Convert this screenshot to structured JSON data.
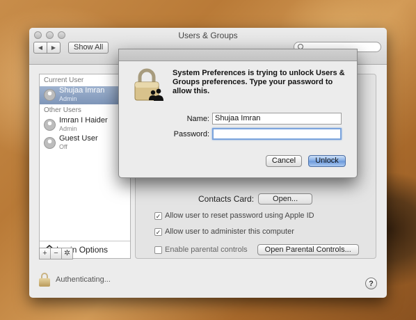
{
  "window": {
    "title": "Users & Groups",
    "nav_back": "◀",
    "nav_forward": "▶",
    "show_all": "Show All",
    "search_placeholder": ""
  },
  "sidebar": {
    "current_user_header": "Current User",
    "current_user": {
      "name": "Shujaa Imran",
      "role": "Admin"
    },
    "other_users_header": "Other Users",
    "other_users": [
      {
        "name": "Imran I Haider",
        "role": "Admin"
      },
      {
        "name": "Guest User",
        "role": "Off"
      }
    ],
    "login_options": "Login Options",
    "add_label": "+",
    "remove_label": "−",
    "action_label": "✲"
  },
  "panel": {
    "contacts_card_label": "Contacts Card:",
    "open_button": "Open...",
    "checks": [
      {
        "label": "Allow user to reset password using Apple ID",
        "checked": true
      },
      {
        "label": "Allow user to administer this computer",
        "checked": true
      },
      {
        "label": "Enable parental controls",
        "checked": false
      }
    ],
    "parental_button": "Open Parental Controls..."
  },
  "footer": {
    "status": "Authenticating...",
    "help": "?"
  },
  "dialog": {
    "message": "System Preferences is trying to unlock Users & Groups preferences. Type your password to allow this.",
    "name_label": "Name:",
    "name_value": "Shujaa Imran",
    "password_label": "Password:",
    "password_value": "",
    "cancel": "Cancel",
    "unlock": "Unlock"
  },
  "colors": {
    "accent": "#6a98db",
    "selection": "#7e95b8"
  }
}
